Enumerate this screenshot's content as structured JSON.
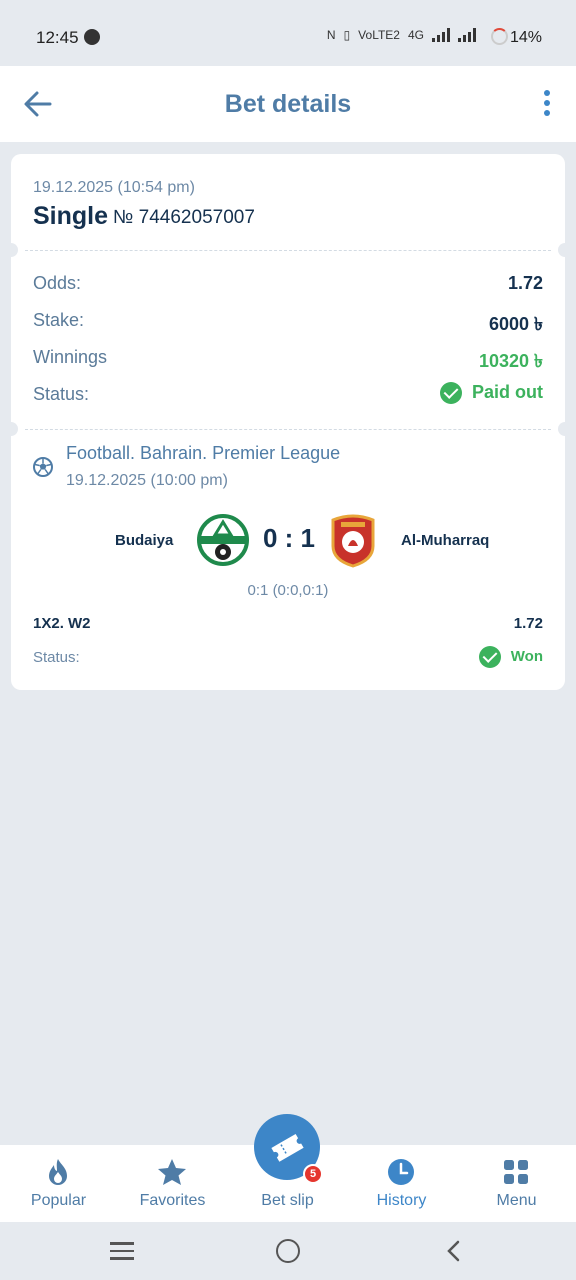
{
  "status_bar": {
    "time": "12:45",
    "network": "4G",
    "volte": "VoLTE2",
    "battery": "14%"
  },
  "header": {
    "title": "Bet details"
  },
  "bet": {
    "date": "19.12.2025 (10:54 pm)",
    "type": "Single",
    "number": "№ 74462057007",
    "rows": {
      "odds_label": "Odds:",
      "odds_value": "1.72",
      "stake_label": "Stake:",
      "stake_value": "6000 ৳",
      "winnings_label": "Winnings",
      "winnings_value": "10320 ৳",
      "status_label": "Status:",
      "status_value": "Paid out"
    }
  },
  "event": {
    "league": "Football. Bahrain. Premier League",
    "date": "19.12.2025 (10:00 pm)",
    "home_team": "Budaiya",
    "away_team": "Al-Muharraq",
    "score": "0 : 1",
    "score_detail": "0:1 (0:0,0:1)",
    "market": "1X2. W2",
    "market_odds": "1.72",
    "status_label": "Status:",
    "status_value": "Won"
  },
  "bottom_nav": {
    "items": [
      {
        "label": "Popular"
      },
      {
        "label": "Favorites"
      },
      {
        "label": "Bet slip"
      },
      {
        "label": "History"
      },
      {
        "label": "Menu"
      }
    ],
    "bet_slip_count": "5"
  },
  "colors": {
    "accent": "#3d86c8",
    "success": "#3cb25d",
    "badge": "#e5362e"
  }
}
